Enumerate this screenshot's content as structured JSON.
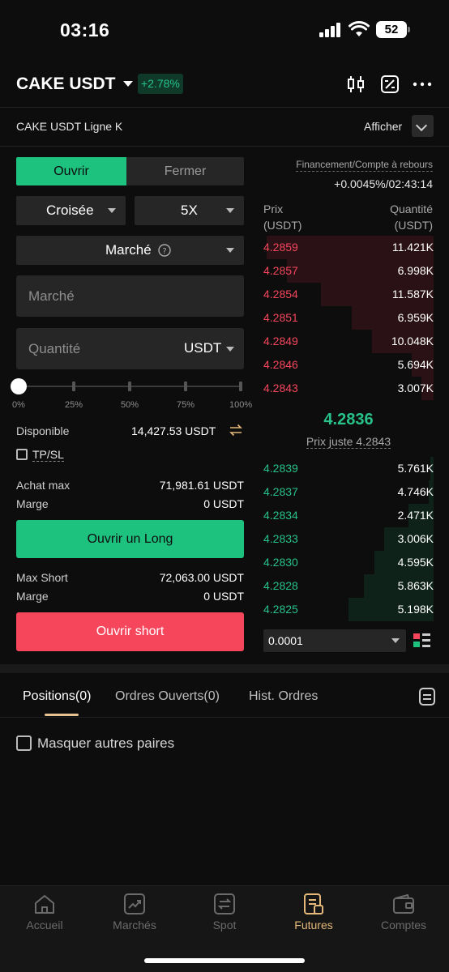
{
  "status_bar": {
    "time": "03:16",
    "battery": "52"
  },
  "header": {
    "pair": "CAKE USDT",
    "change": "+2.78%"
  },
  "subheader": {
    "kline": "CAKE USDT Ligne K",
    "show": "Afficher"
  },
  "trade": {
    "tab_open": "Ouvrir",
    "tab_close": "Fermer",
    "margin_mode": "Croisée",
    "leverage": "5X",
    "order_type": "Marché",
    "price_placeholder": "Marché",
    "qty_placeholder": "Quantité",
    "qty_unit": "USDT",
    "slider_level": 0,
    "slider_marks": [
      "0%",
      "25%",
      "50%",
      "75%",
      "100%"
    ],
    "available_label": "Disponible",
    "available_value": "14,427.53 USDT",
    "tpsl": "TP/SL",
    "buy_max_label": "Achat max",
    "buy_max_value": "71,981.61 USDT",
    "margin_label": "Marge",
    "margin_long_value": "0 USDT",
    "open_long": "Ouvrir un Long",
    "max_short_label": "Max Short",
    "max_short_value": "72,063.00 USDT",
    "margin_short_value": "0 USDT",
    "open_short": "Ouvrir short"
  },
  "orderbook": {
    "funding_label": "Financement/Compte à rebours",
    "funding_value": "+0.0045%/02:43:14",
    "price_header_1": "Prix",
    "price_header_2": "(USDT)",
    "qty_header_1": "Quantité",
    "qty_header_2": "(USDT)",
    "asks": [
      {
        "price": "4.2859",
        "qty": "11.421K",
        "depth": 0.98
      },
      {
        "price": "4.2857",
        "qty": "6.998K",
        "depth": 0.86
      },
      {
        "price": "4.2854",
        "qty": "11.587K",
        "depth": 0.66
      },
      {
        "price": "4.2851",
        "qty": "6.959K",
        "depth": 0.48
      },
      {
        "price": "4.2849",
        "qty": "10.048K",
        "depth": 0.36
      },
      {
        "price": "4.2846",
        "qty": "5.694K",
        "depth": 0.13
      },
      {
        "price": "4.2843",
        "qty": "3.007K",
        "depth": 0.07
      }
    ],
    "mid_price": "4.2836",
    "fair_price": "Prix juste 4.2843",
    "bids": [
      {
        "price": "4.2839",
        "qty": "5.761K",
        "depth": 0.02
      },
      {
        "price": "4.2837",
        "qty": "4.746K",
        "depth": 0.03
      },
      {
        "price": "4.2834",
        "qty": "2.471K",
        "depth": 0.15
      },
      {
        "price": "4.2833",
        "qty": "3.006K",
        "depth": 0.29
      },
      {
        "price": "4.2830",
        "qty": "4.595K",
        "depth": 0.35
      },
      {
        "price": "4.2828",
        "qty": "5.863K",
        "depth": 0.41
      },
      {
        "price": "4.2825",
        "qty": "5.198K",
        "depth": 0.5
      }
    ],
    "precision": "0.0001"
  },
  "positions": {
    "tabs": [
      "Positions(0)",
      "Ordres Ouverts(0)",
      "Hist. Ordres"
    ],
    "hide_others": "Masquer autres paires"
  },
  "nav": {
    "items": [
      {
        "label": "Accueil",
        "icon": "home-icon"
      },
      {
        "label": "Marchés",
        "icon": "chart-icon"
      },
      {
        "label": "Spot",
        "icon": "swap-icon"
      },
      {
        "label": "Futures",
        "icon": "futures-icon"
      },
      {
        "label": "Comptes",
        "icon": "wallet-icon"
      }
    ],
    "active": 3
  },
  "colors": {
    "green": "#1ec27f",
    "red": "#f5465c",
    "accent": "#e5b97a"
  }
}
